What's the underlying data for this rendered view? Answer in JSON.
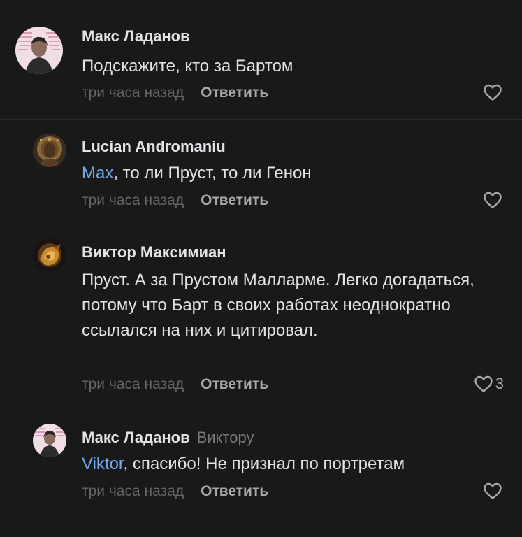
{
  "comments": [
    {
      "author": "Макс Ладанов",
      "reply_to": "",
      "mention": "",
      "text": "Подскажите, кто за Бартом",
      "time": "три часа назад",
      "reply_label": "Ответить",
      "likes": ""
    },
    {
      "author": "Lucian Andromaniu",
      "reply_to": "",
      "mention": "Max",
      "text": ", то ли Пруст, то ли Генон",
      "time": "три часа назад",
      "reply_label": "Ответить",
      "likes": ""
    },
    {
      "author": "Виктор Максимиан",
      "reply_to": "",
      "mention": "",
      "text": "Пруст. А за Прустом Малларме. Легко догадаться, потому что Барт в своих работах неоднократно ссылался на них и цитировал.",
      "time": "три часа назад",
      "reply_label": "Ответить",
      "likes": "3"
    },
    {
      "author": "Макс Ладанов",
      "reply_to": "Виктору",
      "mention": "Viktor",
      "text": ", спасибо! Не признал по портретам",
      "time": "три часа назад",
      "reply_label": "Ответить",
      "likes": ""
    }
  ],
  "colors": {
    "background": "#19191a",
    "mention": "#71aaeb",
    "muted": "#656565",
    "action": "#a6a8ab"
  },
  "icons": {
    "like": "heart-outline-icon"
  }
}
